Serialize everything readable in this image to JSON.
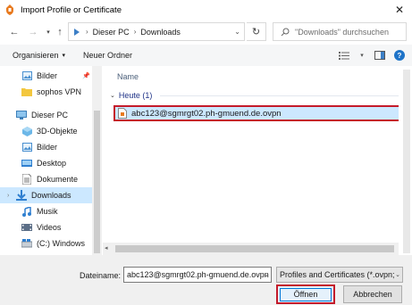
{
  "window": {
    "title": "Import Profile or Certificate"
  },
  "address": {
    "crumbs": [
      "Dieser PC",
      "Downloads"
    ]
  },
  "search": {
    "placeholder": "\"Downloads\" durchsuchen"
  },
  "toolbar": {
    "organize_label": "Organisieren",
    "new_folder_label": "Neuer Ordner"
  },
  "nav": {
    "items": [
      {
        "label": "Bilder",
        "icon": "pictures-icon",
        "pinned": true
      },
      {
        "label": "sophos VPN",
        "icon": "folder-icon"
      },
      {
        "label": "Dieser PC",
        "icon": "computer-icon"
      },
      {
        "label": "3D-Objekte",
        "icon": "3d-objects-icon"
      },
      {
        "label": "Bilder",
        "icon": "pictures-icon"
      },
      {
        "label": "Desktop",
        "icon": "desktop-icon"
      },
      {
        "label": "Dokumente",
        "icon": "documents-icon"
      },
      {
        "label": "Downloads",
        "icon": "downloads-icon",
        "selected": true
      },
      {
        "label": "Musik",
        "icon": "music-icon"
      },
      {
        "label": "Videos",
        "icon": "videos-icon"
      },
      {
        "label": "(C:) Windows",
        "icon": "drive-icon"
      }
    ]
  },
  "content": {
    "column_header": "Name",
    "group_label": "Heute (1)",
    "files": [
      {
        "name": "abc123@sgmrgt02.ph-gmuend.de.ovpn",
        "icon": "ovpn-file-icon",
        "selected": true
      }
    ]
  },
  "footer": {
    "filename_label": "Dateiname:",
    "filename_value": "abc123@sgmrgt02.ph-gmuend.de.ovpn",
    "filetype_value": "Profiles and Certificates (*.ovpn;",
    "open_label": "Öffnen",
    "cancel_label": "Abbrechen"
  },
  "colors": {
    "accent": "#0078d7",
    "highlight": "#c41a2a",
    "selection": "#cce8ff"
  }
}
